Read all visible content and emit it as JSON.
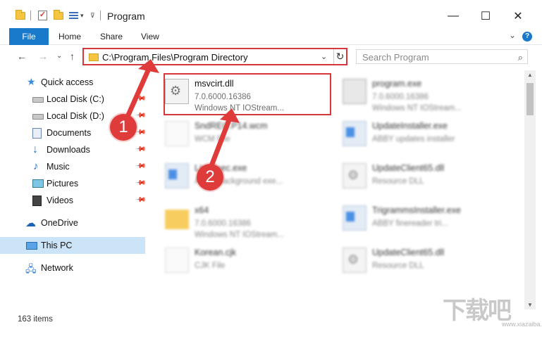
{
  "window": {
    "title": "Program",
    "minimize": "—",
    "maximize": "☐",
    "close": "✕"
  },
  "ribbon": {
    "tabs": [
      "File",
      "Home",
      "Share",
      "View"
    ],
    "expand": "⌄",
    "help": "?"
  },
  "nav": {
    "back": "←",
    "forward": "→",
    "recent": "⌄",
    "up": "↑",
    "address": "C:\\Program Files\\Program Directory",
    "refresh": "↻",
    "search_placeholder": "Search Program",
    "search_icon": "⌕"
  },
  "sidebar": {
    "items": [
      {
        "label": "Quick access",
        "icon": "star-icon"
      },
      {
        "label": "Local Disk (C:)",
        "icon": "disk-icon",
        "pinned": true
      },
      {
        "label": "Local Disk (D:)",
        "icon": "disk-icon",
        "pinned": true
      },
      {
        "label": "Documents",
        "icon": "documents-icon",
        "pinned": true
      },
      {
        "label": "Downloads",
        "icon": "download-icon",
        "pinned": true
      },
      {
        "label": "Music",
        "icon": "music-icon",
        "pinned": true
      },
      {
        "label": "Pictures",
        "icon": "pictures-icon",
        "pinned": true
      },
      {
        "label": "Videos",
        "icon": "videos-icon",
        "pinned": true
      },
      {
        "label": "OneDrive",
        "icon": "cloud-icon"
      },
      {
        "label": "This PC",
        "icon": "computer-icon",
        "selected": true
      },
      {
        "label": "Network",
        "icon": "network-icon"
      }
    ]
  },
  "files": [
    {
      "name": "msvcirt.dll",
      "line1": "7.0.6000.16386",
      "line2": "Windows NT IOStream...",
      "icon": "dll-icon"
    },
    {
      "name": "program.exe",
      "line1": "7.0.6000.16386",
      "line2": "Windows NT IOStream...",
      "icon": "exe-icon"
    },
    {
      "name": "SndREC.P14.wcm",
      "line1": "WCM File",
      "line2": "",
      "icon": "file-icon"
    },
    {
      "name": "UpdateInstaller.exe",
      "line1": "ABBY updates installer",
      "line2": "",
      "icon": "exe-icon"
    },
    {
      "name": "LiveExec.exe",
      "line1": "ABBY background exe...",
      "line2": "",
      "icon": "exe-icon"
    },
    {
      "name": "UpdateClient65.dll",
      "line1": "Resource DLL",
      "line2": "",
      "icon": "dll-icon"
    },
    {
      "name": "x64",
      "line1": "7.0.6000.16386",
      "line2": "Windows NT IOStream...",
      "icon": "folder-icon"
    },
    {
      "name": "TrigrammsInstaller.exe",
      "line1": "ABBY finereader tri...",
      "line2": "",
      "icon": "exe-icon"
    },
    {
      "name": "Korean.cjk",
      "line1": "CJK File",
      "line2": "",
      "icon": "file-icon"
    },
    {
      "name": "UpdateClient65.dll",
      "line1": "Resource DLL",
      "line2": "",
      "icon": "dll-icon"
    }
  ],
  "status": {
    "item_count": "163 items"
  },
  "annotations": {
    "badge1": "1",
    "badge2": "2",
    "color": "#d7373a"
  },
  "watermark": {
    "text": "下载吧",
    "url": "www.xiazaiba.com"
  },
  "colors": {
    "accent": "#1979ca",
    "selected_bg": "#cce4f7",
    "highlight": "#d7373a"
  }
}
